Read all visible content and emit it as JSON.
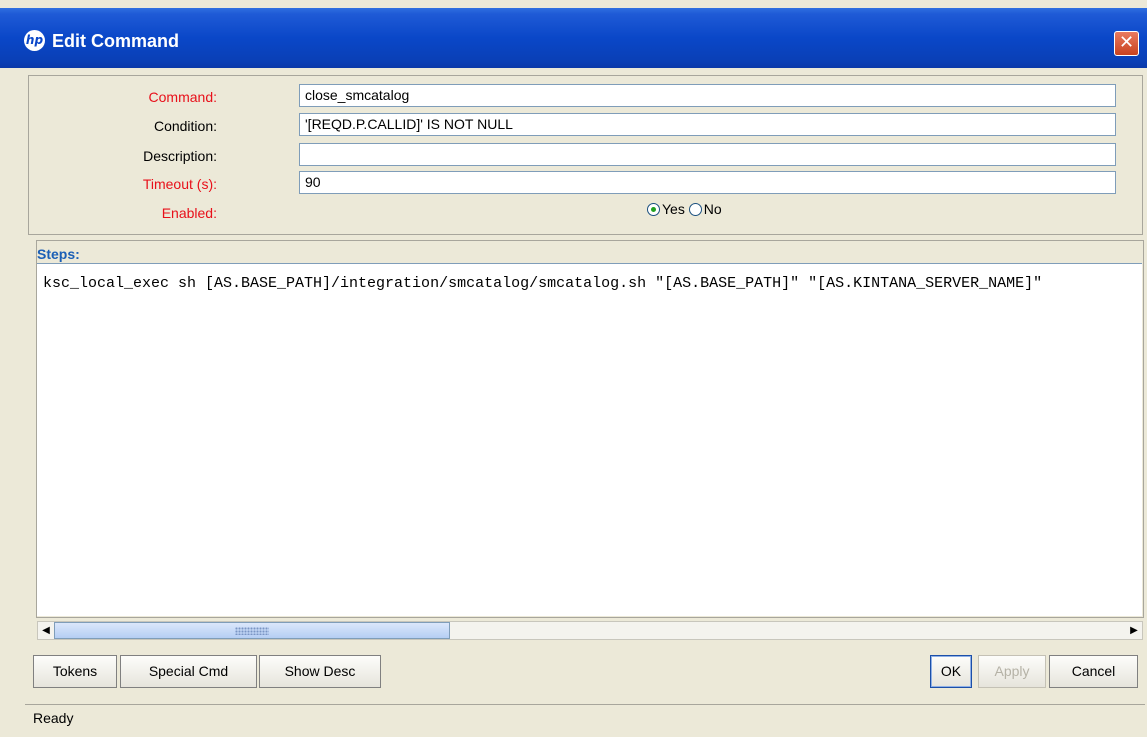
{
  "window": {
    "title": "Edit Command",
    "logo_text": "hp",
    "close_glyph": "✕"
  },
  "form": {
    "command_label": "Command:",
    "command_value": "close_smcatalog",
    "condition_label": "Condition:",
    "condition_value": "'[REQD.P.CALLID]' IS NOT NULL",
    "description_label": "Description:",
    "description_value": "",
    "timeout_label": "Timeout (s):",
    "timeout_value": "90",
    "enabled_label": "Enabled:",
    "enabled_yes": "Yes",
    "enabled_no": "No",
    "enabled_selected": "Yes"
  },
  "steps": {
    "label": "Steps:",
    "text": "ksc_local_exec sh [AS.BASE_PATH]/integration/smcatalog/smcatalog.sh \"[AS.BASE_PATH]\" \"[AS.KINTANA_SERVER_NAME]\""
  },
  "buttons": {
    "tokens": "Tokens",
    "special_cmd": "Special Cmd",
    "show_desc": "Show Desc",
    "ok": "OK",
    "apply": "Apply",
    "cancel": "Cancel"
  },
  "status": {
    "text": "Ready"
  },
  "colors": {
    "required_label": "#e8101a",
    "title_bar": "#0a47c8",
    "steps_label": "#1b5fb6",
    "background": "#ece9d8"
  },
  "icons": {
    "logo": "hp-logo-icon",
    "close": "close-icon",
    "scroll_left": "arrow-left-icon",
    "scroll_right": "arrow-right-icon"
  }
}
